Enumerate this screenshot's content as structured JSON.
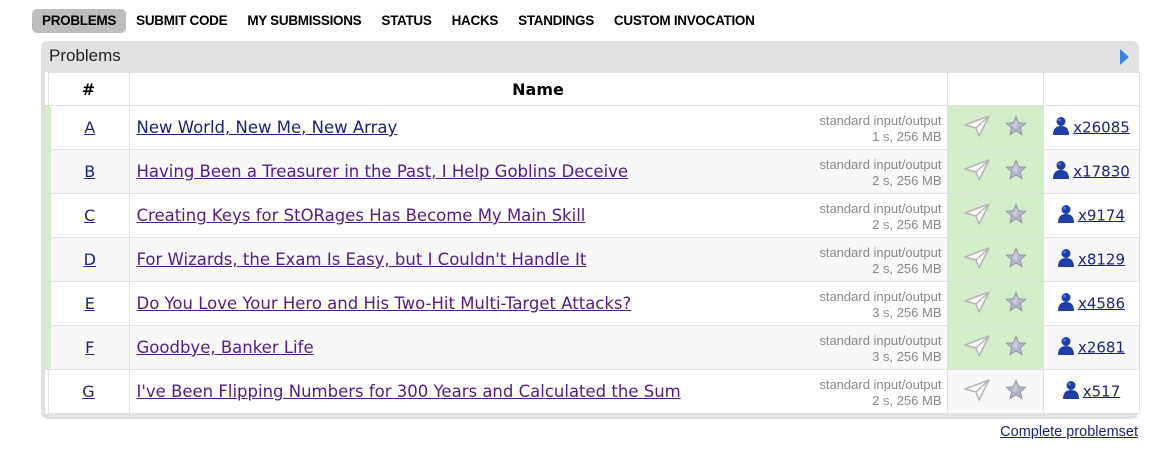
{
  "menu": [
    {
      "label": "PROBLEMS",
      "active": true
    },
    {
      "label": "SUBMIT CODE",
      "active": false
    },
    {
      "label": "MY SUBMISSIONS",
      "active": false
    },
    {
      "label": "STATUS",
      "active": false
    },
    {
      "label": "HACKS",
      "active": false
    },
    {
      "label": "STANDINGS",
      "active": false
    },
    {
      "label": "CUSTOM INVOCATION",
      "active": false
    }
  ],
  "box": {
    "title": "Problems",
    "arrow_icon": "arrow-right-icon",
    "accent_color": "#3b86d8"
  },
  "table": {
    "headers": {
      "index": "#",
      "name": "Name",
      "actions": "",
      "solved": ""
    },
    "rows": [
      {
        "index": "A",
        "name": "New World, New Me, New Array",
        "io": "standard input/output",
        "limits": "1 s, 256 MB",
        "solved": "x26085",
        "accepted": true
      },
      {
        "index": "B",
        "name": "Having Been a Treasurer in the Past, I Help Goblins Deceive",
        "io": "standard input/output",
        "limits": "2 s, 256 MB",
        "solved": "x17830",
        "accepted": true
      },
      {
        "index": "C",
        "name": "Creating Keys for StORages Has Become My Main Skill",
        "io": "standard input/output",
        "limits": "2 s, 256 MB",
        "solved": "x9174",
        "accepted": true
      },
      {
        "index": "D",
        "name": "For Wizards, the Exam Is Easy, but I Couldn't Handle It",
        "io": "standard input/output",
        "limits": "2 s, 256 MB",
        "solved": "x8129",
        "accepted": true
      },
      {
        "index": "E",
        "name": "Do You Love Your Hero and His Two-Hit Multi-Target Attacks?",
        "io": "standard input/output",
        "limits": "3 s, 256 MB",
        "solved": "x4586",
        "accepted": true
      },
      {
        "index": "F",
        "name": "Goodbye, Banker Life",
        "io": "standard input/output",
        "limits": "3 s, 256 MB",
        "solved": "x2681",
        "accepted": true
      },
      {
        "index": "G",
        "name": "I've Been Flipping Numbers for 300 Years and Calculated the Sum",
        "io": "standard input/output",
        "limits": "2 s, 256 MB",
        "solved": "x517",
        "accepted": false
      }
    ],
    "icons": {
      "submit": "paper-plane-icon",
      "favorite": "star-icon",
      "solved": "user-icon"
    },
    "colors": {
      "accepted": "#d4edc9",
      "link": "#1a237e"
    }
  },
  "footer": {
    "complete_link": "Complete problemset"
  }
}
